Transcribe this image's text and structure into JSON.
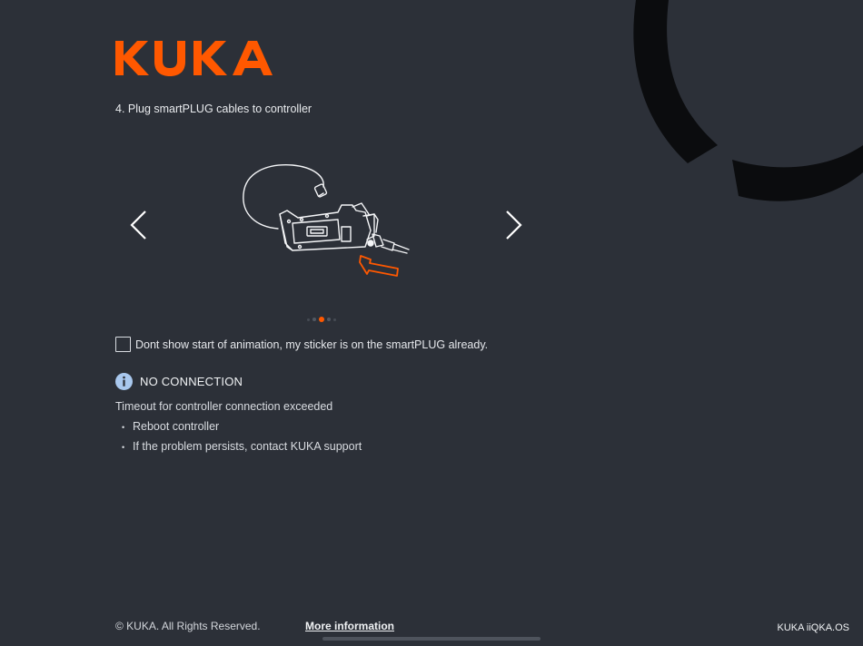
{
  "brand": {
    "logo_text": "KUKA",
    "accent_color": "#ff5800"
  },
  "step": {
    "title": "4. Plug smartPLUG cables to controller"
  },
  "carousel": {
    "prev_icon": "chevron-left-icon",
    "next_icon": "chevron-right-icon",
    "illustration": "smartPLUG-cable-illustration",
    "page_count": 5,
    "active_index": 2
  },
  "option": {
    "checkbox_label": "Dont show start of animation, my sticker is on the smartPLUG already.",
    "checked": false
  },
  "alert": {
    "icon": "info-icon",
    "title": "NO CONNECTION",
    "description": "Timeout for controller connection exceeded",
    "items": [
      "Reboot controller",
      "If the problem persists, contact KUKA support"
    ]
  },
  "footer": {
    "copyright": "© KUKA. All Rights Reserved.",
    "more_info_link": "More information",
    "os_name": "KUKA iiQKA.OS"
  },
  "colors": {
    "background": "#2c3038",
    "info": "#a9c8ee"
  }
}
